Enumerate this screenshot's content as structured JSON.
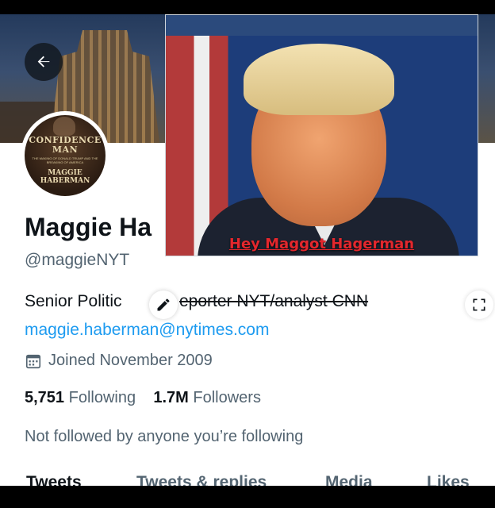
{
  "profile": {
    "name": "Maggie Ha",
    "handle": "@maggieNYT",
    "bio_left": "Senior Politic",
    "bio_right": "eporter NYT/analyst CNN",
    "link": "maggie.haberman@nytimes.com",
    "joined": "Joined November 2009",
    "following_count": "5,751",
    "following_label": "Following",
    "followers_count": "1.7M",
    "followers_label": "Followers",
    "not_followed": "Not followed by anyone you’re following"
  },
  "avatar_cover": {
    "title": "CONFIDENCE MAN",
    "subtitle": "THE MAKING OF DONALD TRUMP AND THE BREAKING OF AMERICA",
    "author": "MAGGIE HABERMAN"
  },
  "overlay": {
    "caption": "Hey Maggot Hagerman"
  },
  "tabs": [
    {
      "label": "Tweets"
    },
    {
      "label": "Tweets & replies"
    },
    {
      "label": "Media"
    },
    {
      "label": "Likes"
    }
  ],
  "icons": {
    "back": "back-arrow-icon",
    "edit": "pencil-icon",
    "expand": "expand-icon",
    "calendar": "calendar-icon"
  },
  "colors": {
    "link": "#1d9bf0",
    "secondary_text": "#536471",
    "primary_text": "#0f1419",
    "caption": "#e3272d"
  }
}
